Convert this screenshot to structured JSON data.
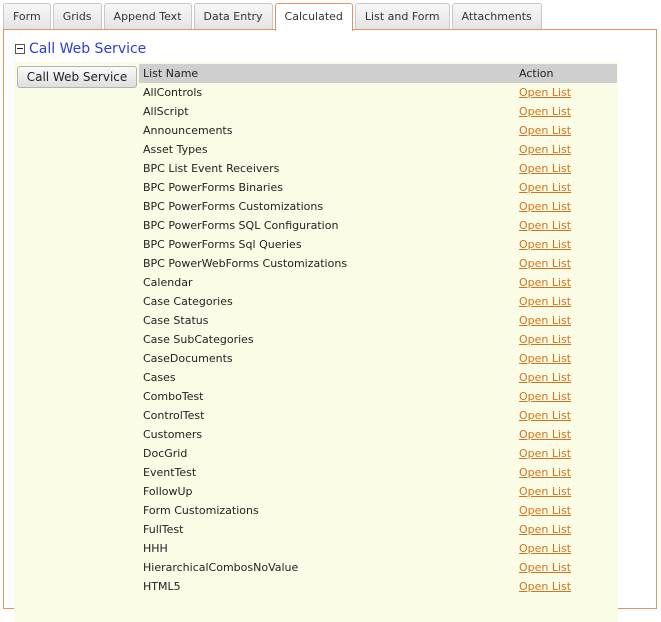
{
  "tabs": [
    {
      "label": "Form",
      "active": false
    },
    {
      "label": "Grids",
      "active": false
    },
    {
      "label": "Append Text",
      "active": false
    },
    {
      "label": "Data Entry",
      "active": false
    },
    {
      "label": "Calculated",
      "active": true
    },
    {
      "label": "List and Form",
      "active": false
    },
    {
      "label": "Attachments",
      "active": false
    }
  ],
  "section": {
    "title": "Call Web Service",
    "toggle_icon": "collapse-minus-icon"
  },
  "button": {
    "label": "Call Web Service"
  },
  "grid": {
    "columns": [
      "List Name",
      "Action"
    ],
    "action_label": "Open List",
    "rows": [
      "AllControls",
      "AllScript",
      "Announcements",
      "Asset Types",
      "BPC List Event Receivers",
      "BPC PowerForms Binaries",
      "BPC PowerForms Customizations",
      "BPC PowerForms SQL Configuration",
      "BPC PowerForms Sql Queries",
      "BPC PowerWebForms Customizations",
      "Calendar",
      "Case Categories",
      "Case Status",
      "Case SubCategories",
      "CaseDocuments",
      "Cases",
      "ComboTest",
      "ControlTest",
      "Customers",
      "DocGrid",
      "EventTest",
      "FollowUp",
      "Form Customizations",
      "FullTest",
      "HHH",
      "HierarchicalCombosNoValue",
      "HTML5"
    ]
  },
  "colors": {
    "accent": "#e8935a",
    "link": "#d5731c",
    "title": "#2a3fd6",
    "body_bg": "#fbfce6",
    "header_bg": "#cfcfcf"
  }
}
